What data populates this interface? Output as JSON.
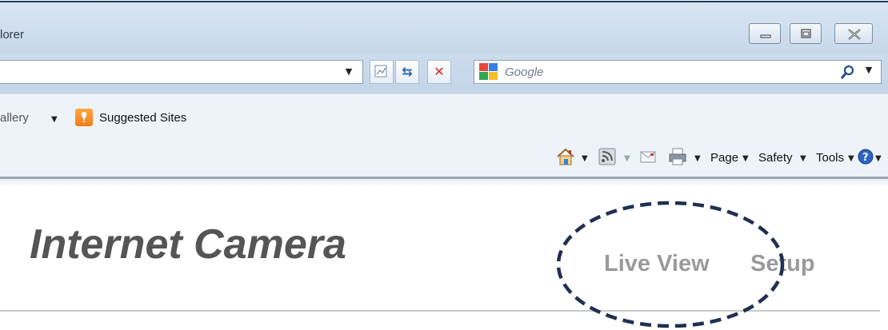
{
  "window": {
    "title_fragment": "lorer",
    "controls": [
      "minimize",
      "maximize",
      "close"
    ]
  },
  "address_bar": {
    "value": "",
    "buttons": [
      "compatibility-view",
      "refresh",
      "stop"
    ]
  },
  "search": {
    "placeholder": "Google"
  },
  "favorites_bar": {
    "gallery_fragment": "allery",
    "suggested_sites": "Suggested Sites"
  },
  "command_bar": {
    "page": "Page",
    "safety": "Safety",
    "tools": "Tools"
  },
  "page": {
    "title": "Internet Camera",
    "nav": {
      "live_view": "Live View",
      "setup": "Setup"
    }
  },
  "colors": {
    "accent_frame": "#1f3a5a",
    "title_text": "#555555",
    "nav_text": "#9a9a9a",
    "annotation": "#1f3050"
  },
  "icons": [
    "home-icon",
    "rss-feed-icon",
    "read-mail-icon",
    "print-icon",
    "help-icon",
    "search-icon",
    "google-icon",
    "suggested-sites-icon"
  ]
}
